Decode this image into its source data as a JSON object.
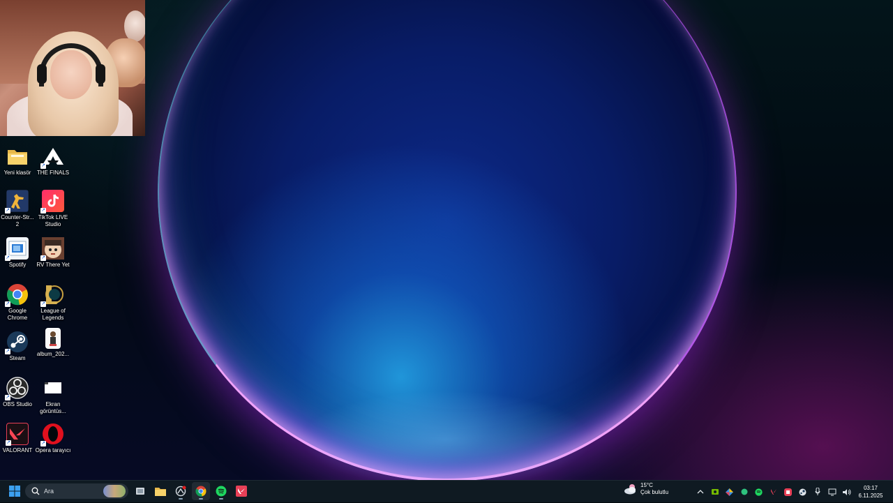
{
  "desktop": {
    "icons": [
      {
        "label": "Yeni klasör",
        "icon": "folder-icon"
      },
      {
        "label": "THE FINALS",
        "icon": "the-finals-icon"
      },
      {
        "label": "Counter-Str... 2",
        "icon": "counter-strike-icon"
      },
      {
        "label": "TikTok LIVE Studio",
        "icon": "tiktok-live-icon"
      },
      {
        "label": "Spotify",
        "icon": "spotify-shortcut-icon"
      },
      {
        "label": "RV There Yet",
        "icon": "rv-there-yet-icon"
      },
      {
        "label": "Google Chrome",
        "icon": "chrome-icon"
      },
      {
        "label": "League of Legends",
        "icon": "league-of-legends-icon"
      },
      {
        "label": "Steam",
        "icon": "steam-icon"
      },
      {
        "label": "album_202...",
        "icon": "image-file-icon"
      },
      {
        "label": "OBS Studio",
        "icon": "obs-icon"
      },
      {
        "label": "Ekran görüntüs...",
        "icon": "screenshot-file-icon"
      },
      {
        "label": "VALORANT",
        "icon": "valorant-icon"
      },
      {
        "label": "Opera tarayıcı",
        "icon": "opera-icon"
      }
    ]
  },
  "taskbar": {
    "search_placeholder": "Ara",
    "apps": [
      "start-icon",
      "task-view-icon",
      "file-explorer-icon",
      "app-icon",
      "chrome-icon",
      "spotify-icon",
      "valorant-icon"
    ],
    "weather": {
      "temp": "15°C",
      "condition": "Çok bulutlu"
    },
    "clock": {
      "time": "03:17",
      "date": "6.11.2025"
    }
  },
  "colors": {
    "taskbar": "#0f1a22",
    "accent": "#0067c0"
  }
}
